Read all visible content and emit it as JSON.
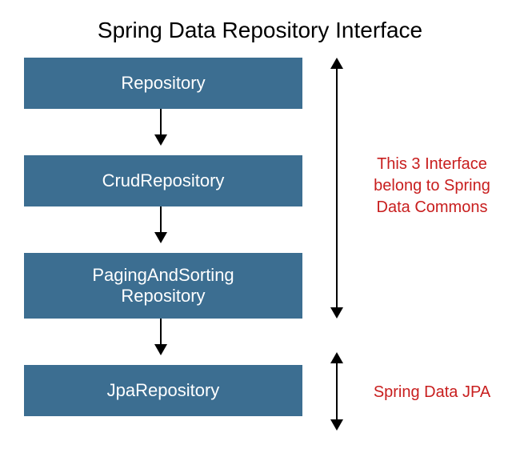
{
  "title": "Spring Data Repository Interface",
  "boxes": {
    "repository": "Repository",
    "crud": "CrudRepository",
    "paging_line1": "PagingAndSorting",
    "paging_line2": "Repository",
    "jpa": "JpaRepository"
  },
  "annotations": {
    "commons_line1": "This 3 Interface",
    "commons_line2": "belong to Spring",
    "commons_line3": "Data Commons",
    "jpa": "Spring Data JPA"
  },
  "colors": {
    "box_bg": "#3c6e91",
    "box_text": "#ffffff",
    "annotation": "#c81e1e"
  }
}
